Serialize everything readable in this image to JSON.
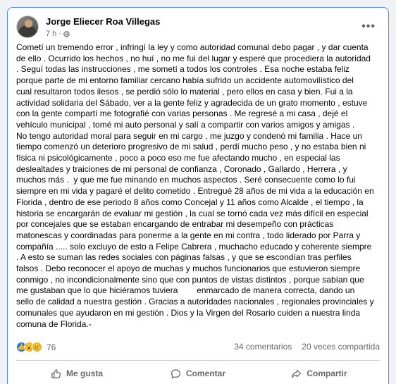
{
  "post": {
    "author": "Jorge Eliecer Roa Villegas",
    "time": "7 h",
    "separator": "·",
    "body_lines": [
      "Cometí un tremendo error , infringí la ley y como autoridad comunal debo pagar , y dar cuenta",
      "de ello . Ocurrido los hechos , no huí , no me fui del lugar y esperé que procediera la autoridad",
      ". Seguí todas las instrucciones , me sometí a todos los controles . Esa noche estaba feliz",
      "porque parte de mi entorno familiar cercano había sufrido un accidente automovilístico del",
      "cual resultaron todos ilesos , se perdió sólo lo material , pero ellos en casa y bien. Fui a la",
      "actividad solidaria del Sábado, ver a la gente feliz y agradecida de un grato momento , estuve",
      "con la gente compartí me fotografié con varias personas . Me regresé a mi casa , dejé el",
      "vehículo municipal , tomé mi auto personal y salí a compartir con varios amigos y amigas .",
      "No tengo autoridad moral para seguir en mi cargo , me juzgo y condenó mi familia . Hace un",
      "tiempo comenzó un deterioro progresivo de mi salud , perdí mucho peso , y no estaba bien ni",
      "física ni psicológicamente , poco a poco eso me fue afectando mucho , en especial las",
      "deslealtades y traiciones de mi personal de confianza , Coronado , Gallardo , Herrera , y",
      "muchos más .  y que me fue minando en muchos aspectos . Seré consecuente como lo fui",
      "siempre en mi vida y pagaré el delito cometido . Entregué 28 años de mi vida a la educación en",
      "Florida , dentro de ese periodo 8 años como Concejal y 11 años como Alcalde , el tiempo , la",
      "historia se encargarán de evaluar mi gestión , la cual se tornó cada vez más difícil en especial",
      "por concejales que se estaban encargando de entrabar mi desempeño con prácticas",
      "matonescas y coordinadas para ponerme a la gente en mi contra , todo liderado por Parra y",
      "compañía ..... solo excluyo de esto a Felipe Cabrera , muchacho educado y coherente siempre",
      ". A esto se suman las redes sociales con páginas falsas , y que se escondían tras perfiles",
      "falsos . Debo reconocer el apoyo de muchas y muchos funcionarios que estuvieron siempre",
      "conmigo , no incondicionalmente sino que con puntos de vistas distintos , porque sabían que",
      "me gustaban que lo que hiciéramos tuviera        enmarcado de manera correcta, dando un",
      "sello de calidad a nuestra gestión . Gracias a autoridades nacionales , regionales provinciales y",
      "comunales que ayudaron en mi gestión . Dios y la Virgen del Rosario cuiden a nuestra linda",
      "comuna de Florida.-"
    ]
  },
  "stats": {
    "reaction_count": "76",
    "comments": "34 comentarios",
    "shares": "20 veces compartida"
  },
  "actions": {
    "like": "Me gusta",
    "comment": "Comentar",
    "share": "Compartir"
  },
  "colors": {
    "card_border": "#4a90e2",
    "like_blue": "#1877f2",
    "muted": "#65676b"
  }
}
